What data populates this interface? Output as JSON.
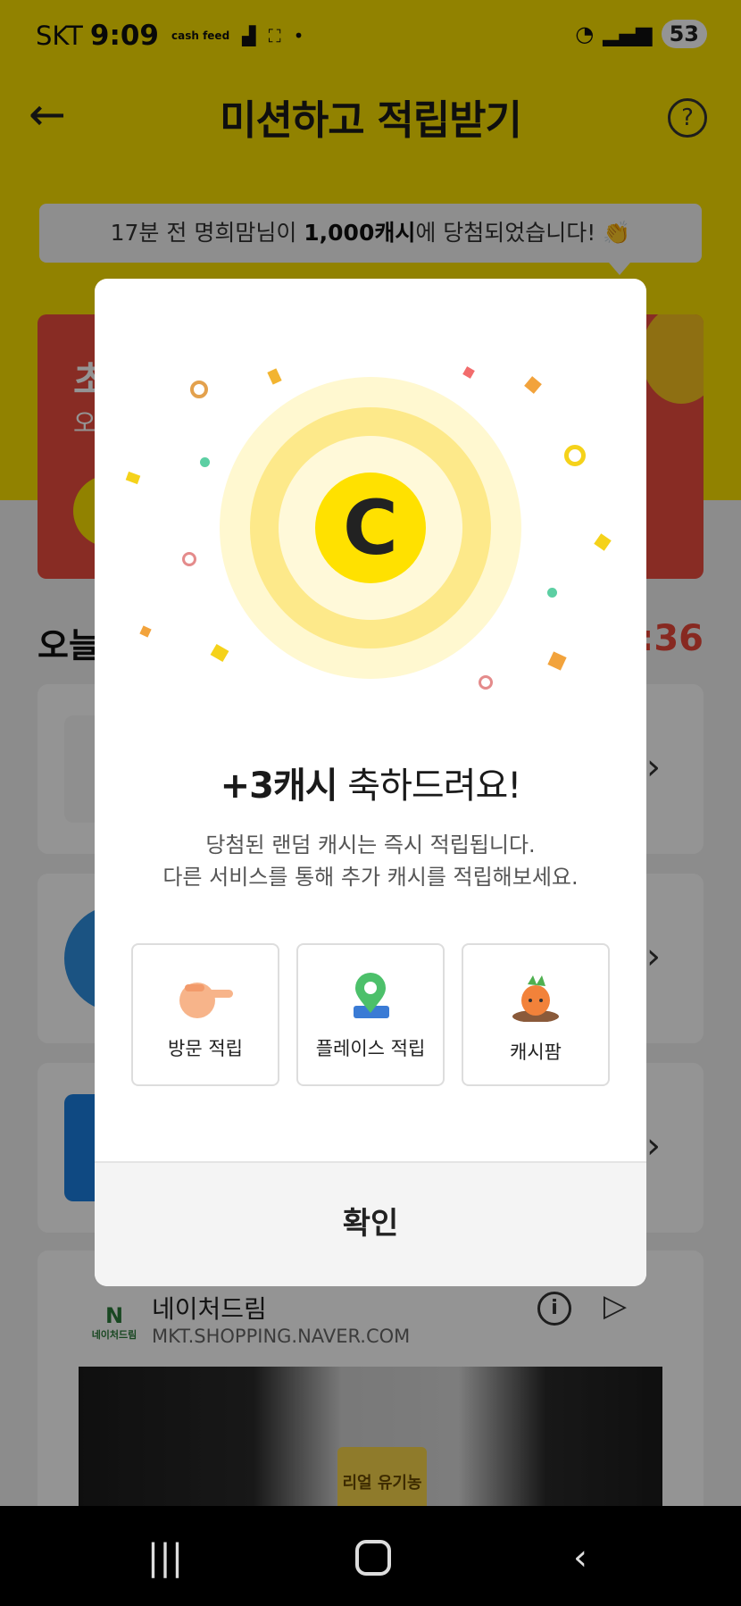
{
  "status_bar": {
    "carrier": "SKT",
    "time": "9:09",
    "cash_label": "cash feed",
    "battery": "53"
  },
  "header": {
    "title": "미션하고 적립받기",
    "help": "?"
  },
  "winner_banner": {
    "prefix": "17분 전 명희맘님이 ",
    "amount": "1,000캐시",
    "suffix": "에 당첨되었습니다! 👏"
  },
  "red_card": {
    "title": "초",
    "subtitle": "오"
  },
  "today": {
    "title": "오늘",
    "timer": ":36"
  },
  "modal": {
    "title_amount": "+3캐시",
    "title_rest": " 축하드려요!",
    "desc_line1": "당첨된 랜덤 캐시는 즉시 적립됩니다.",
    "desc_line2": "다른 서비스를 통해 추가 캐시를 적립해보세요.",
    "coin_letter": "C",
    "services": [
      {
        "label": "방문 적립",
        "icon": "pointing-hand-icon"
      },
      {
        "label": "플레이스 적립",
        "icon": "map-pin-icon"
      },
      {
        "label": "캐시팜",
        "icon": "carrot-icon"
      }
    ],
    "confirm_label": "확인"
  },
  "ad": {
    "logo_text": "네이처드림",
    "name": "네이처드림",
    "url": "MKT.SHOPPING.NAVER.COM",
    "product_text": "리얼 유기농"
  },
  "colors": {
    "brand_yellow": "#fae100",
    "timer_red": "#e8483a",
    "card_red": "#ea4c3e"
  }
}
